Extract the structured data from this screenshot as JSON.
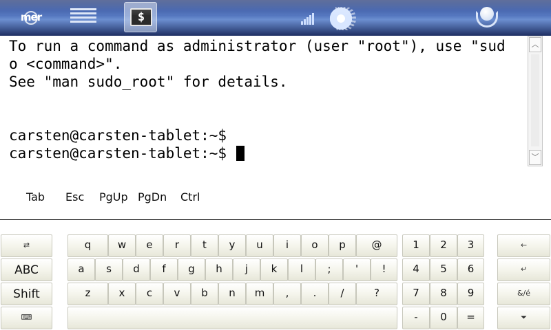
{
  "topbar": {
    "logo_text": "mer",
    "app_tile_glyph": "$",
    "icons": [
      "app-list-icon",
      "terminal-icon",
      "signal-strength-icon",
      "battery-icon",
      "power-icon"
    ]
  },
  "terminal": {
    "lines": [
      "To run a command as administrator (user \"root\"), use \"sud",
      "o <command>\".",
      "See \"man sudo_root\" for details.",
      "",
      "",
      "carsten@carsten-tablet:~$",
      "carsten@carsten-tablet:~$ "
    ]
  },
  "scrollbar": {
    "up_glyph": "︿",
    "down_glyph": "﹀"
  },
  "special_keys": [
    "Tab",
    "Esc",
    "PgUp",
    "PgDn",
    "Ctrl"
  ],
  "keyboard": {
    "left_keys": [
      "⇄",
      "ABC",
      "Shift",
      "⌨"
    ],
    "letter_rows": [
      [
        "q",
        "w",
        "e",
        "r",
        "t",
        "y",
        "u",
        "i",
        "o",
        "p",
        "@"
      ],
      [
        "a",
        "s",
        "d",
        "f",
        "g",
        "h",
        "j",
        "k",
        "l",
        ";",
        "'",
        "!"
      ],
      [
        "z",
        "x",
        "c",
        "v",
        "b",
        "n",
        "m",
        ",",
        ".",
        "/",
        "?"
      ]
    ],
    "space_label": "",
    "numpad": [
      [
        "1",
        "2",
        "3"
      ],
      [
        "4",
        "5",
        "6"
      ],
      [
        "7",
        "8",
        "9"
      ],
      [
        "-",
        "0",
        "="
      ]
    ],
    "right_keys": [
      "←",
      "↵",
      "&/é",
      "⏷"
    ]
  }
}
